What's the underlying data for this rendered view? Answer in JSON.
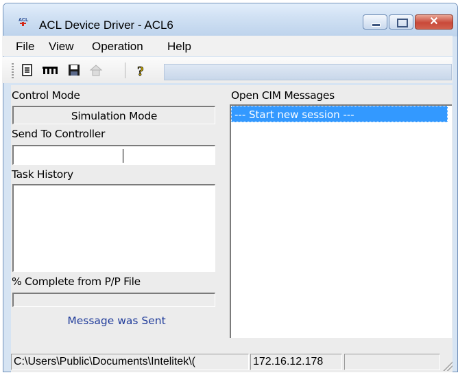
{
  "window": {
    "title": "ACL Device Driver - ACL6",
    "app_icon": "acl-app-icon",
    "close_symbol": "✕"
  },
  "menu": {
    "file": "File",
    "view": "View",
    "operation": "Operation",
    "help": "Help"
  },
  "toolbar": {
    "icons": [
      "document-icon",
      "controller-icon",
      "save-icon",
      "home-icon",
      "help-icon"
    ]
  },
  "left_panel": {
    "control_mode_label": "Control Mode",
    "control_mode_value": "Simulation Mode",
    "send_to_controller_label": "Send To Controller",
    "send_to_controller_value": "",
    "task_history_label": "Task History",
    "percent_complete_label": "% Complete from P/P File",
    "percent_complete_fraction": 0,
    "message": "Message was Sent"
  },
  "right_panel": {
    "open_cim_label": "Open CIM Messages",
    "messages": [
      "--- Start new session ---"
    ]
  },
  "statusbar": {
    "path": "C:\\Users\\Public\\Documents\\Intelitek\\(",
    "ip": "172.16.12.178",
    "extra": ""
  },
  "colors": {
    "selection": "#3399ff",
    "message_text": "#1f3b9a"
  }
}
